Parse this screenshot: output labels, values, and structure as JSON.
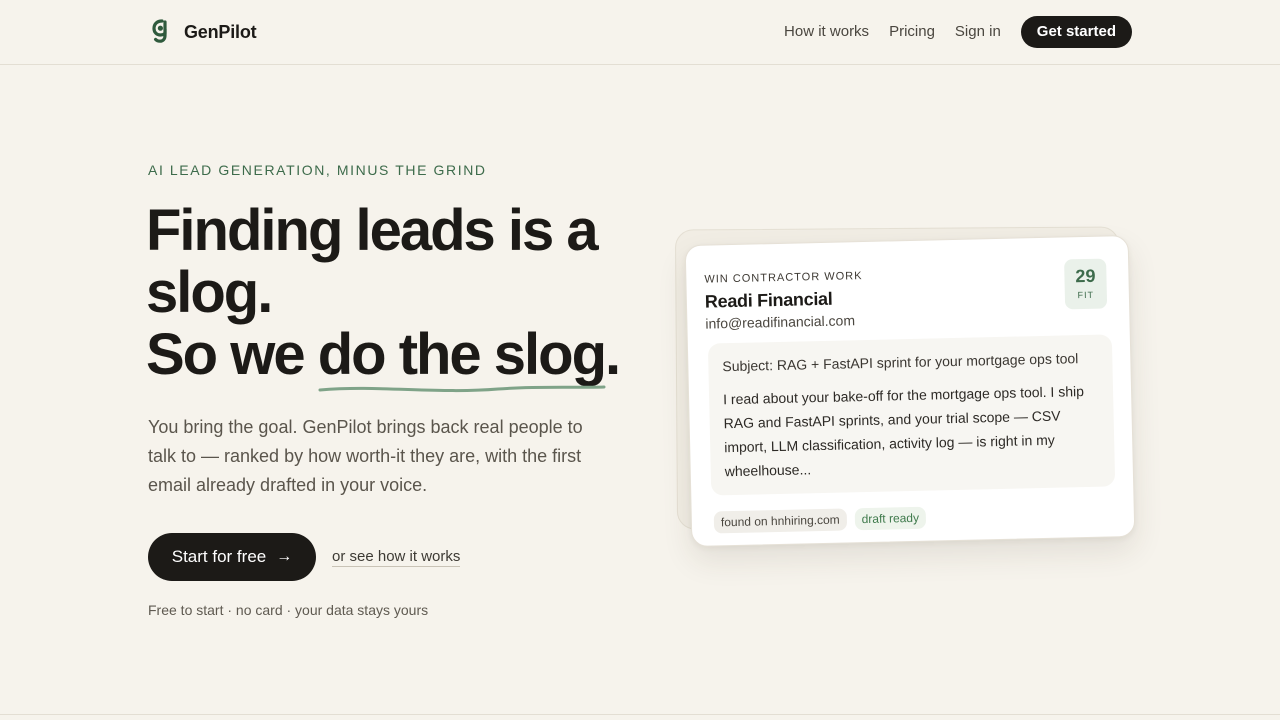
{
  "colors": {
    "background": "#f6f3ec",
    "ink": "#1c1a17",
    "accent_green": "#3d6b4b",
    "squiggle": "#7fa388"
  },
  "nav": {
    "brand": "GenPilot",
    "brand_icon": "g-logo-icon",
    "links": [
      "How it works",
      "Pricing",
      "Sign in"
    ],
    "cta": "Get started"
  },
  "hero": {
    "eyebrow": "AI LEAD GENERATION, MINUS THE GRIND",
    "headline_line1": "Finding leads is a",
    "headline_line2": "slog.",
    "headline_line3_prefix": "So we ",
    "headline_line3_highlight": "do the slog",
    "headline_line3_suffix": ".",
    "lede": "You bring the goal. GenPilot brings back real people to talk to — ranked by how worth-it they are, with the first email already drafted in your voice.",
    "primary_cta": "Start for free",
    "primary_cta_icon": "arrow-right-icon",
    "secondary_cta": "or see how it works",
    "fineprint": "Free to start · no card · your data stays yours"
  },
  "lead_card": {
    "kicker": "WIN CONTRACTOR WORK",
    "company": "Readi Financial",
    "email": "info@readifinancial.com",
    "fit_score": "29",
    "fit_label": "FIT",
    "subject": "Subject: RAG + FastAPI sprint for your mortgage ops tool",
    "body": "I read about your bake-off for the mortgage ops tool. I ship RAG and FastAPI sprints, and your trial scope — CSV import, LLM classification, activity log — is right in my wheelhouse...",
    "tags": [
      "found on hnhiring.com",
      "draft ready"
    ]
  }
}
